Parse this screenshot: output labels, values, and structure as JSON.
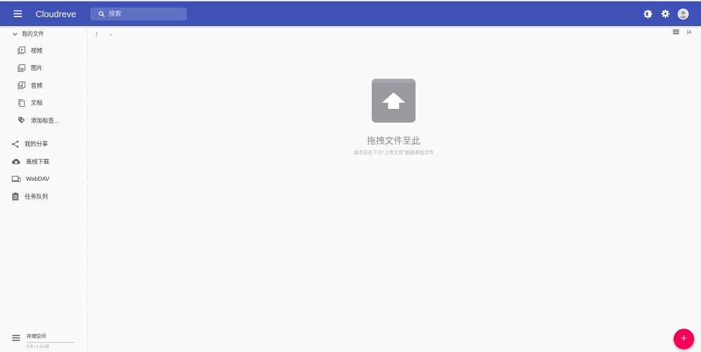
{
  "appbar": {
    "title": "Cloudreve",
    "search_placeholder": "搜索",
    "color": "#3f51b5"
  },
  "sidebar": {
    "folder_label": "我的文件",
    "sub_items": [
      {
        "label": "视频",
        "icon": "video-icon"
      },
      {
        "label": "图片",
        "icon": "image-icon"
      },
      {
        "label": "音频",
        "icon": "audio-icon"
      },
      {
        "label": "文档",
        "icon": "document-icon"
      },
      {
        "label": "添加标签...",
        "icon": "tag-icon"
      }
    ],
    "top_items": [
      {
        "label": "我的分享",
        "icon": "share-icon"
      },
      {
        "label": "离线下载",
        "icon": "cloud-download-icon"
      },
      {
        "label": "WebDAV",
        "icon": "devices-icon"
      },
      {
        "label": "任务队列",
        "icon": "task-queue-icon"
      }
    ],
    "storage": {
      "title": "存储空间",
      "usage": "0 B / 1.0 GB",
      "used_fraction": 0
    }
  },
  "breadcrumb": {
    "root": "/",
    "chevron": "›"
  },
  "toolbar": {
    "sort_label": "|A"
  },
  "empty_state": {
    "title": "拖拽文件至此",
    "hint": "或点击右下方\"上传文件\"按钮添加文件"
  },
  "fab": {
    "label": "+",
    "color": "#f50057"
  }
}
